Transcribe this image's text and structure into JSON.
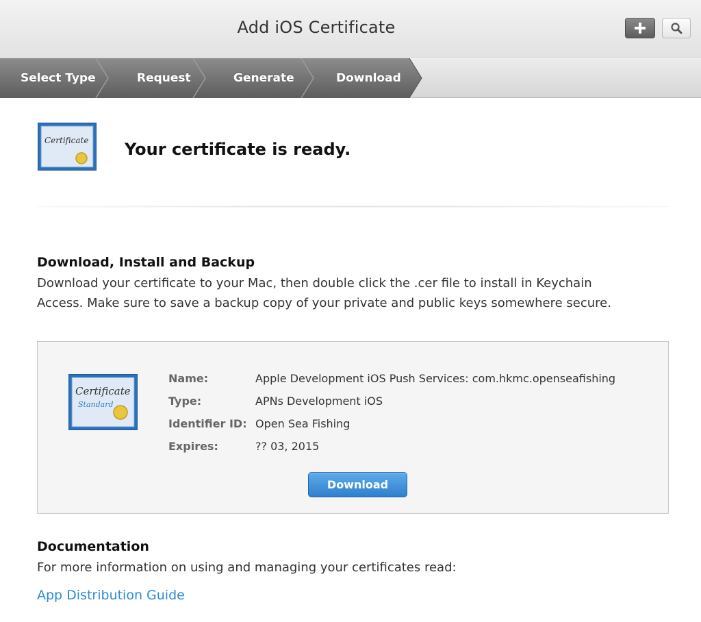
{
  "header": {
    "title": "Add iOS Certificate",
    "add_icon": "plus-icon",
    "search_icon": "search-icon"
  },
  "steps": [
    {
      "label": "Select Type"
    },
    {
      "label": "Request"
    },
    {
      "label": "Generate"
    },
    {
      "label": "Download",
      "active": true
    }
  ],
  "ready": {
    "title": "Your certificate is ready.",
    "icon": "certificate-icon",
    "icon_text": "Certificate"
  },
  "backup": {
    "heading": "Download, Install and Backup",
    "line1": "Download your certificate to your Mac, then double click the .cer file to install in Keychain",
    "line2": "Access. Make sure to save a backup copy of your private and public keys somewhere secure."
  },
  "certificate": {
    "icon_text": "Certificate",
    "icon_subtext": "Standard",
    "fields": [
      {
        "label": "Name:",
        "value": "Apple Development iOS Push Services: com.hkmc.openseafishing"
      },
      {
        "label": "Type:",
        "value": "APNs Development iOS"
      },
      {
        "label": "Identifier ID:",
        "value": "Open Sea Fishing"
      },
      {
        "label": "Expires:",
        "value": "?? 03, 2015"
      }
    ],
    "download_label": "Download"
  },
  "documentation": {
    "heading": "Documentation",
    "text": "For more information on using and managing your certificates read:",
    "link": "App Distribution Guide"
  },
  "colors": {
    "accent_blue": "#2f80cd",
    "link_blue": "#2c8ad6",
    "step_dark": "#7a7a7a"
  }
}
